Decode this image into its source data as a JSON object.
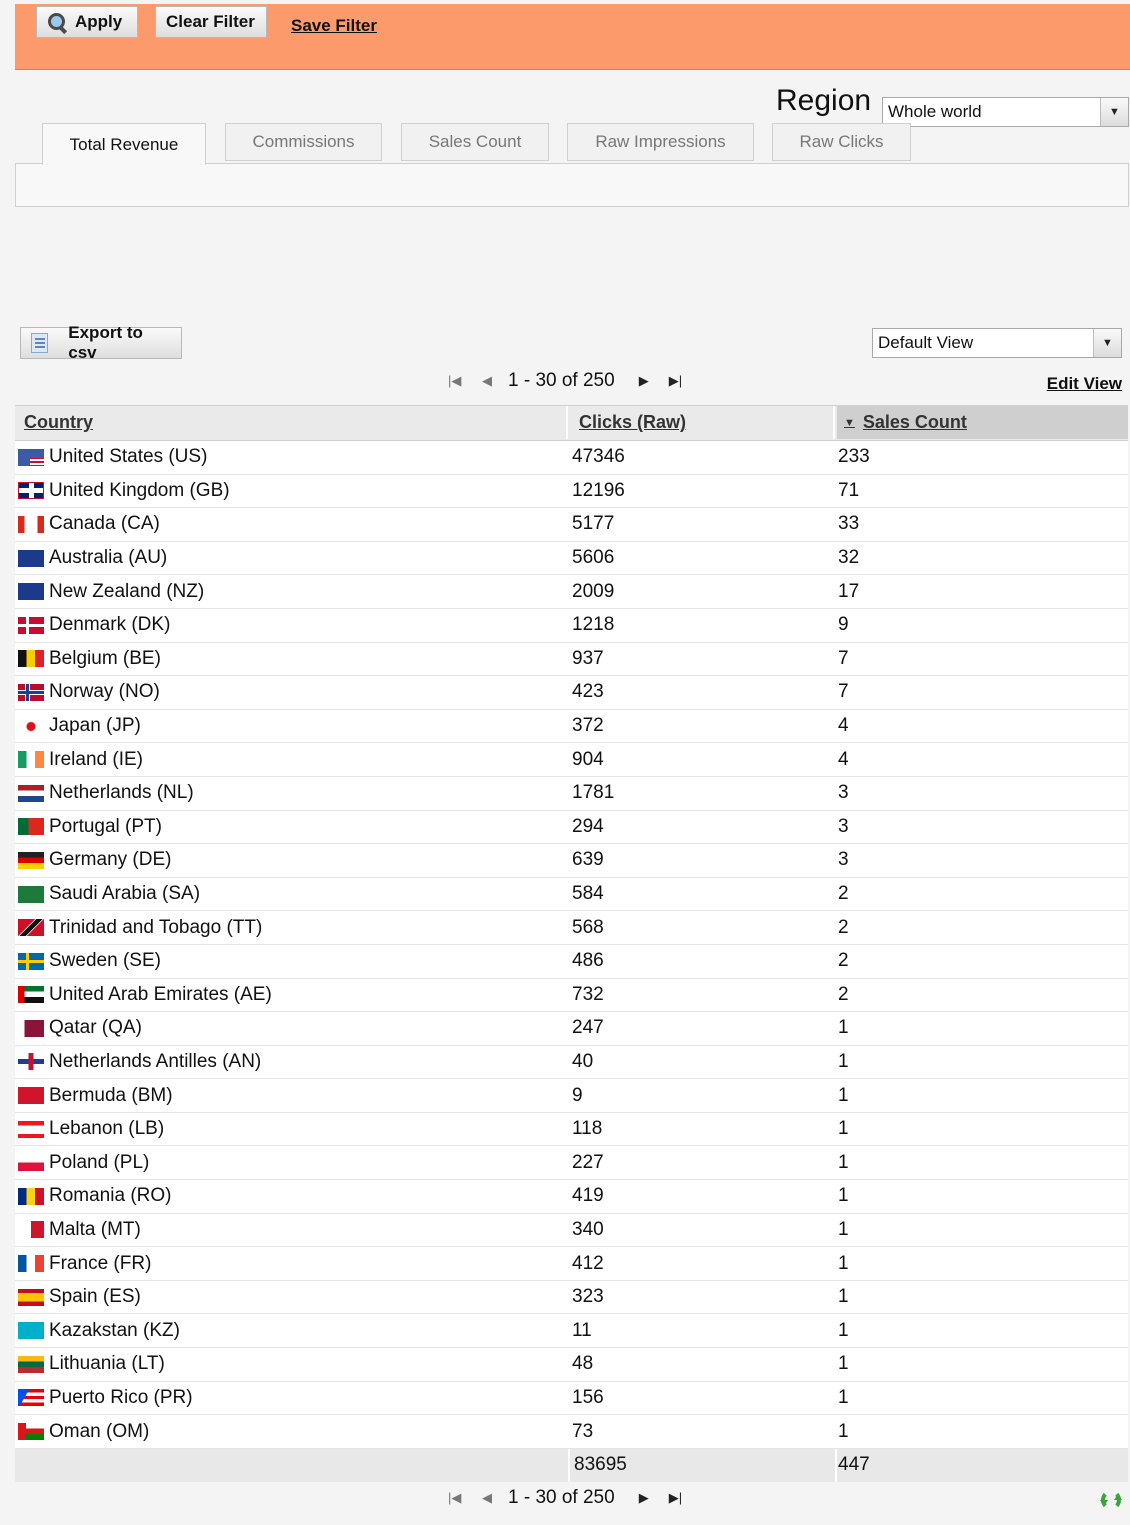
{
  "filter_bar": {
    "apply_label": "Apply",
    "clear_label": "Clear Filter",
    "save_label": "Save Filter"
  },
  "region": {
    "label": "Region",
    "selected": "Whole world"
  },
  "tabs": [
    {
      "label": "Total Revenue",
      "active": true
    },
    {
      "label": "Commissions",
      "active": false
    },
    {
      "label": "Sales Count",
      "active": false
    },
    {
      "label": "Raw Impressions",
      "active": false
    },
    {
      "label": "Raw Clicks",
      "active": false
    }
  ],
  "grid": {
    "export_label": "Export to csv",
    "view_selected": "Default View",
    "edit_view_label": "Edit View",
    "pager_label": "1 - 30 of 250",
    "columns": {
      "country": "Country",
      "clicks": "Clicks (Raw)",
      "sales": "Sales Count"
    },
    "rows": [
      {
        "country": "United States (US)",
        "clicks": "47346",
        "sales": "233",
        "flag": "us"
      },
      {
        "country": "United Kingdom (GB)",
        "clicks": "12196",
        "sales": "71",
        "flag": "gb"
      },
      {
        "country": "Canada (CA)",
        "clicks": "5177",
        "sales": "33",
        "flag": "ca"
      },
      {
        "country": "Australia (AU)",
        "clicks": "5606",
        "sales": "32",
        "flag": "au"
      },
      {
        "country": "New Zealand (NZ)",
        "clicks": "2009",
        "sales": "17",
        "flag": "nz"
      },
      {
        "country": "Denmark (DK)",
        "clicks": "1218",
        "sales": "9",
        "flag": "dk"
      },
      {
        "country": "Belgium (BE)",
        "clicks": "937",
        "sales": "7",
        "flag": "be"
      },
      {
        "country": "Norway (NO)",
        "clicks": "423",
        "sales": "7",
        "flag": "no"
      },
      {
        "country": "Japan (JP)",
        "clicks": "372",
        "sales": "4",
        "flag": "jp"
      },
      {
        "country": "Ireland (IE)",
        "clicks": "904",
        "sales": "4",
        "flag": "ie"
      },
      {
        "country": "Netherlands (NL)",
        "clicks": "1781",
        "sales": "3",
        "flag": "nl"
      },
      {
        "country": "Portugal (PT)",
        "clicks": "294",
        "sales": "3",
        "flag": "pt"
      },
      {
        "country": "Germany (DE)",
        "clicks": "639",
        "sales": "3",
        "flag": "de"
      },
      {
        "country": "Saudi Arabia (SA)",
        "clicks": "584",
        "sales": "2",
        "flag": "sa"
      },
      {
        "country": "Trinidad and Tobago (TT)",
        "clicks": "568",
        "sales": "2",
        "flag": "tt"
      },
      {
        "country": "Sweden (SE)",
        "clicks": "486",
        "sales": "2",
        "flag": "se"
      },
      {
        "country": "United Arab Emirates (AE)",
        "clicks": "732",
        "sales": "2",
        "flag": "ae"
      },
      {
        "country": "Qatar (QA)",
        "clicks": "247",
        "sales": "1",
        "flag": "qa"
      },
      {
        "country": "Netherlands Antilles (AN)",
        "clicks": "40",
        "sales": "1",
        "flag": "an"
      },
      {
        "country": "Bermuda (BM)",
        "clicks": "9",
        "sales": "1",
        "flag": "bm"
      },
      {
        "country": "Lebanon (LB)",
        "clicks": "118",
        "sales": "1",
        "flag": "lb"
      },
      {
        "country": "Poland (PL)",
        "clicks": "227",
        "sales": "1",
        "flag": "pl"
      },
      {
        "country": "Romania (RO)",
        "clicks": "419",
        "sales": "1",
        "flag": "ro"
      },
      {
        "country": "Malta (MT)",
        "clicks": "340",
        "sales": "1",
        "flag": "mt"
      },
      {
        "country": "France (FR)",
        "clicks": "412",
        "sales": "1",
        "flag": "fr"
      },
      {
        "country": "Spain (ES)",
        "clicks": "323",
        "sales": "1",
        "flag": "es"
      },
      {
        "country": "Kazakstan (KZ)",
        "clicks": "11",
        "sales": "1",
        "flag": "kz"
      },
      {
        "country": "Lithuania (LT)",
        "clicks": "48",
        "sales": "1",
        "flag": "lt"
      },
      {
        "country": "Puerto Rico (PR)",
        "clicks": "156",
        "sales": "1",
        "flag": "pr"
      },
      {
        "country": "Oman (OM)",
        "clicks": "73",
        "sales": "1",
        "flag": "om"
      }
    ],
    "totals": {
      "clicks": "83695",
      "sales": "447"
    }
  }
}
